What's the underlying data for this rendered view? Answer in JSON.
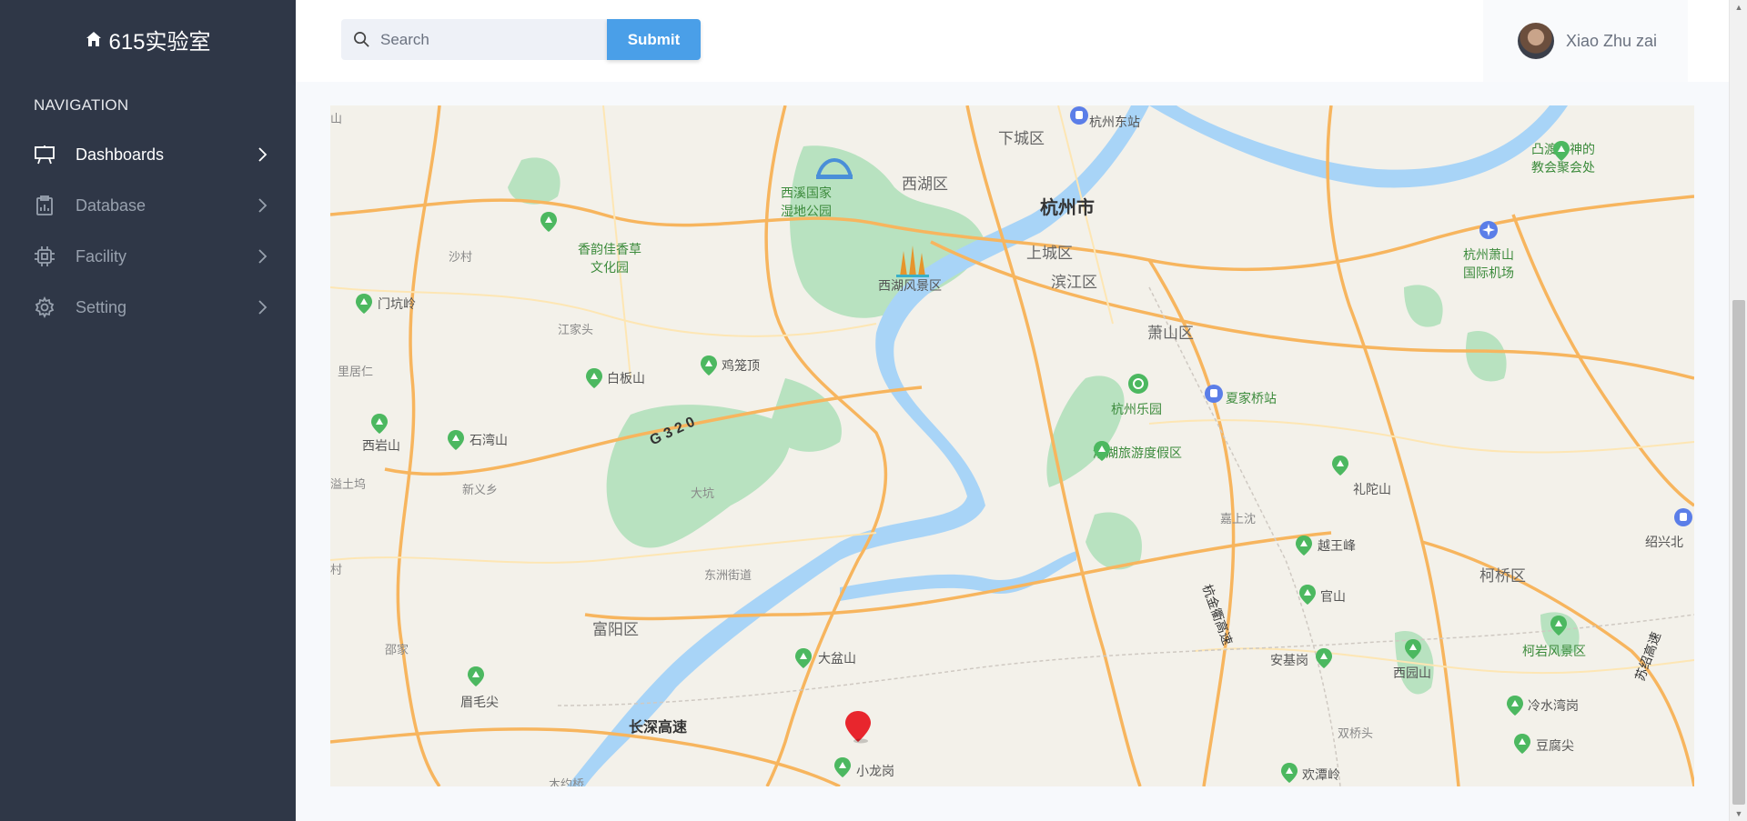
{
  "brand": {
    "title": "615实验室",
    "icon": "home-icon"
  },
  "sidebar": {
    "heading": "NAVIGATION",
    "items": [
      {
        "label": "Dashboards",
        "icon": "presentation-icon",
        "active": true
      },
      {
        "label": "Database",
        "icon": "clipboard-chart-icon",
        "active": false
      },
      {
        "label": "Facility",
        "icon": "chip-icon",
        "active": false
      },
      {
        "label": "Setting",
        "icon": "gear-icon",
        "active": false
      }
    ]
  },
  "header": {
    "search": {
      "placeholder": "Search",
      "value": ""
    },
    "submit_label": "Submit",
    "user": {
      "name": "Xiao Zhu zai"
    }
  },
  "map": {
    "labels": {
      "city": "杭州市",
      "xihu_qu": "西湖区",
      "xiacheng": "下城区",
      "shangcheng": "上城区",
      "binjiang": "滨江区",
      "xiaoshan": "萧山区",
      "fuyang": "富阳区",
      "keqiao": "柯桥区",
      "dongzhou": "东洲街道",
      "hangzhou_east": "杭州东站",
      "xixi": "西溪国家\n湿地公园",
      "xihu_scenic": "西湖风景区",
      "xiangyun": "香韵佳香草\n文化园",
      "airport": "杭州萧山\n国际机场",
      "church": "凸渡沙神的\n教会聚会处",
      "xiajiaqiao": "夏家桥站",
      "leyuan": "杭州乐园",
      "xianghu": "湘湖旅游度假区",
      "menkeng": "门坑岭",
      "jiulong": "鸡笼顶",
      "baiban": "白板山",
      "xiyan": "西岩山",
      "shiwan": "石湾山",
      "jiangjiatou": "江家头",
      "shacun": "沙村",
      "liju": "里居仁",
      "xinyixiang": "新义乡",
      "dakeng": "大坑",
      "damang": "大盆山",
      "meimao": "眉毛尖",
      "xiaolong": "小龙岗",
      "lituo": "礼陀山",
      "yuewang": "越王峰",
      "guanshan": "官山",
      "anjigang": "安基岗",
      "xiyuan": "西园山",
      "keyan": "柯岩风景区",
      "lengshui": "冷水湾岗",
      "doufu": "豆腐尖",
      "huantan": "欢潭岭",
      "shaoxing_north": "绍兴北",
      "shuangqiaotou": "双桥头",
      "changshen": "长深高速",
      "g320": "G 3 2 0",
      "hangjin": "杭金衢高速",
      "suzhou": "苏绍高速",
      "jiashang": "嘉上沈",
      "shantu": "溢土坞",
      "cun": "村",
      "shan_left": "山",
      "bujia": "邵家",
      "mu": "木约桥"
    },
    "marker_icon": "location-pin-icon",
    "poi_icon": "mountain-pin-icon"
  },
  "colors": {
    "sidebar_bg": "#2f3747",
    "accent": "#4a9fe8",
    "water": "#a8d4f7",
    "park": "#b8e2c0",
    "road_major": "#f7b55e",
    "marker": "#e8262d"
  }
}
